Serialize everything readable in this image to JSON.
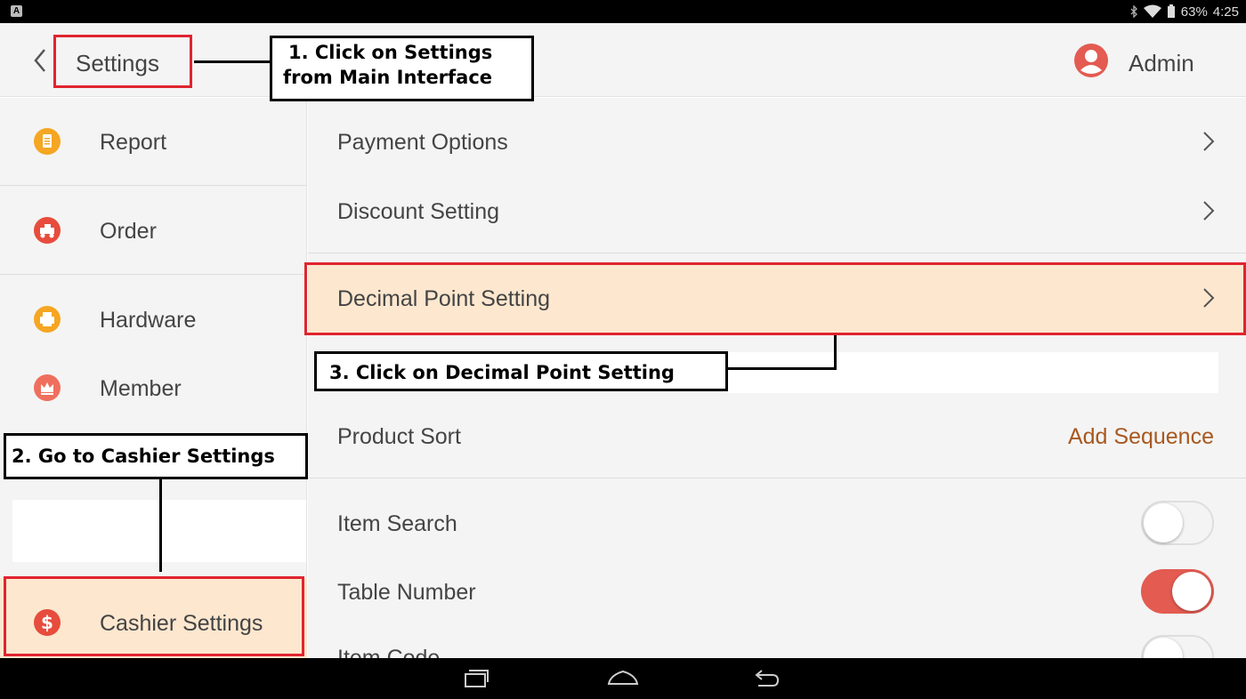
{
  "status_bar": {
    "battery": "63%",
    "time": "4:25"
  },
  "header": {
    "title": "Settings",
    "user": "Admin"
  },
  "sidebar": {
    "items": [
      {
        "label": "Report",
        "icon": "report-icon",
        "color": "#f5a623"
      },
      {
        "label": "Order",
        "icon": "order-icon",
        "color": "#e74c3c"
      },
      {
        "label": "Hardware",
        "icon": "printer-icon",
        "color": "#f5a623"
      },
      {
        "label": "Member",
        "icon": "crown-icon",
        "color": "#ef6f5e"
      },
      {
        "label": "Cashier Settings",
        "icon": "dollar-icon",
        "color": "#e74c3c",
        "selected": true
      }
    ]
  },
  "main": {
    "rows": [
      {
        "label": "Payment Options"
      },
      {
        "label": "Discount Setting"
      },
      {
        "label": "Decimal Point Setting",
        "highlighted": true
      },
      {
        "label": "Product Sort",
        "action": "Add Sequence"
      },
      {
        "label": "Item Search",
        "toggle": false
      },
      {
        "label": "Table Number",
        "toggle": true
      },
      {
        "label": "Item Code",
        "toggle": false
      }
    ]
  },
  "annotations": {
    "step1_line1": "1. Click on Settings",
    "step1_line2": "from Main Interface",
    "step2": "2. Go to Cashier Settings",
    "step3": "3. Click on Decimal Point Setting"
  },
  "colors": {
    "accent": "#e35b51",
    "highlight_bg": "#fde7cf",
    "annotation_border": "#e0242f",
    "link": "#a8581f"
  }
}
